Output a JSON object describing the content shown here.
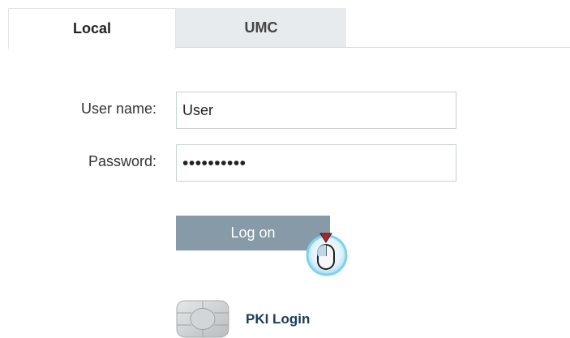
{
  "tabs": [
    {
      "label": "Local",
      "active": true
    },
    {
      "label": "UMC",
      "active": false
    }
  ],
  "form": {
    "username_label": "User name:",
    "username_value": "User",
    "password_label": "Password:",
    "password_value": "••••••••••"
  },
  "logon_label": "Log on",
  "pki": {
    "label": "PKI Login",
    "icon": "smartcard-chip-icon"
  },
  "cursor": {
    "icon": "mouse-click-cursor-icon"
  },
  "colors": {
    "button_bg": "#869aa7",
    "inactive_tab_bg": "#e7ebee",
    "pki_text": "#1a3d5a",
    "cursor_ring": "#7fd1ec",
    "cursor_arrow": "#b3222a"
  }
}
